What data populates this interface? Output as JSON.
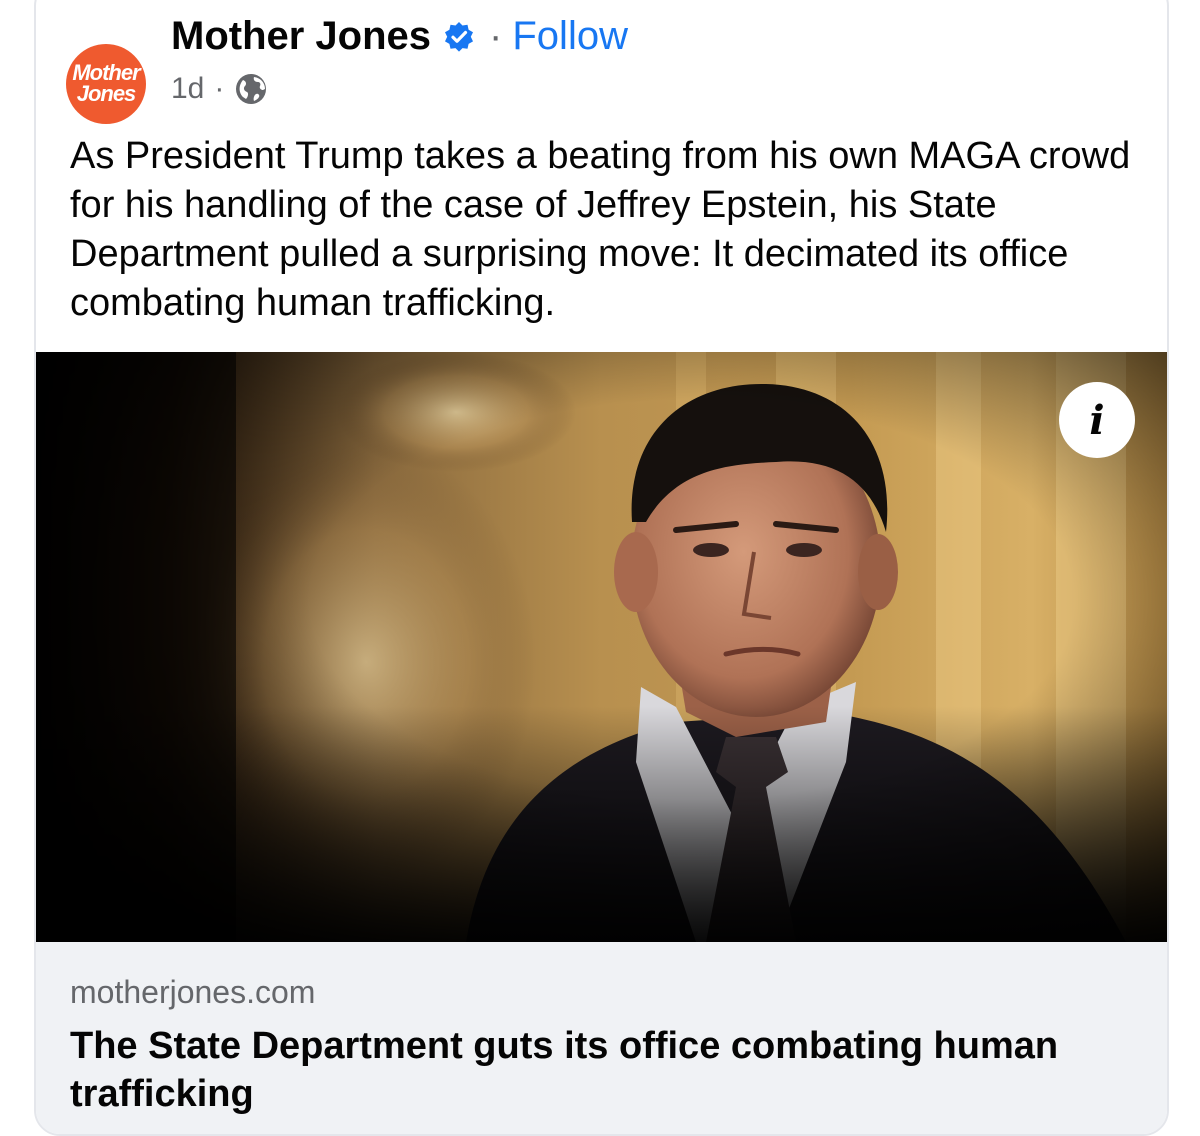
{
  "post": {
    "avatar_text_line1": "Mother",
    "avatar_text_line2": "Jones",
    "page_name": "Mother Jones",
    "separator": "·",
    "follow_label": "Follow",
    "timestamp": "1d",
    "meta_separator": "·",
    "audience_icon": "globe-icon",
    "verified_icon": "verified-badge-icon",
    "text": "As President Trump takes a beating from his own MAGA crowd for his handling of the case of Jeffrey Epstein, his State Department pulled a surprising move: It decimated its office combating human trafficking."
  },
  "link_preview": {
    "info_icon_label": "i",
    "domain": "motherjones.com",
    "title": "The State Department guts its office combating human trafficking"
  },
  "colors": {
    "brand_orange": "#ef5a2f",
    "link_blue": "#1877f2",
    "verified_blue": "#1877f2",
    "secondary_text": "#65676b",
    "preview_bg": "#f0f2f5"
  }
}
